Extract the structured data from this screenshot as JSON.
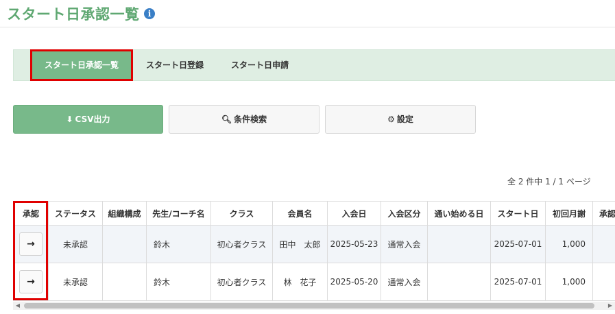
{
  "header": {
    "title": "スタート日承認一覧",
    "info_icon": "i"
  },
  "tabs": [
    {
      "label": "スタート日承認一覧",
      "active": true
    },
    {
      "label": "スタート日登録",
      "active": false
    },
    {
      "label": "スタート日申請",
      "active": false
    }
  ],
  "toolbar": {
    "csv_label": "CSV出力",
    "search_label": "条件検索",
    "settings_label": "設定",
    "download_icon": "download-icon",
    "search_icon": "search-icon",
    "settings_icon": "gear-icon"
  },
  "pagination": {
    "summary": "全 2 件中 1 / 1 ページ"
  },
  "table": {
    "headers": [
      "承認",
      "ステータス",
      "組織構成",
      "先生/コーチ名",
      "クラス",
      "会員名",
      "入会日",
      "入会区分",
      "通い始める日",
      "スタート日",
      "初回月謝",
      "承認日"
    ],
    "rows": [
      {
        "approve": "→",
        "status": "未承認",
        "org": "",
        "teacher": "鈴木",
        "class": "初心者クラス",
        "member": "田中　太郎",
        "join_date": "2025-05-23",
        "join_type": "通常入会",
        "attend_start": "",
        "start_date": "2025-07-01",
        "first_fee": "1,000",
        "approved_date": ""
      },
      {
        "approve": "→",
        "status": "未承認",
        "org": "",
        "teacher": "鈴木",
        "class": "初心者クラス",
        "member": "林　花子",
        "join_date": "2025-05-20",
        "join_type": "通常入会",
        "attend_start": "",
        "start_date": "2025-07-01",
        "first_fee": "1,000",
        "approved_date": ""
      }
    ]
  },
  "scrollbar": {
    "left_arrow": "◀",
    "right_arrow": "▶"
  },
  "colors": {
    "accent": "#78b98a",
    "title": "#5fa872",
    "highlight": "#e00000",
    "info": "#3a7fc6"
  }
}
